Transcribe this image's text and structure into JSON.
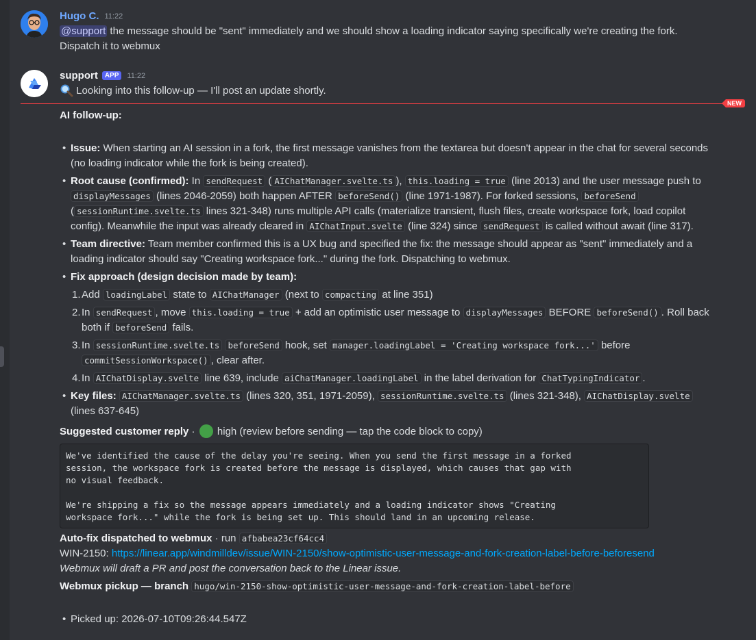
{
  "msg1": {
    "author": "Hugo C.",
    "time": "11:22",
    "mention": "@support",
    "text1": " the message should be \"sent\" immediately and we should show a loading indicator saying specifically we're creating the fork.",
    "text2": "Dispatch it to webmux"
  },
  "msg2": {
    "author": "support",
    "badge": "APP",
    "time": "11:22",
    "text": "Looking into this follow-up — I'll post an update shortly."
  },
  "new_label": "NEW",
  "body": {
    "heading": "AI follow-up:",
    "issue_label": "Issue:",
    "issue_l1": " When starting an AI session in a fork, the first message vanishes from the textarea but doesn't appear in the chat for several seconds",
    "issue_l2": "(no loading indicator while the fork is being created).",
    "rc_label": "Root cause (confirmed):",
    "rc_l1_a": " In ",
    "rc_code1": "sendRequest",
    "rc_l1_b": " (",
    "rc_code2": "AIChatManager.svelte.ts",
    "rc_l1_c": "), ",
    "rc_code3": "this.loading = true",
    "rc_l1_d": " (line 2013) and the user message push to",
    "rc_code4": "displayMessages",
    "rc_l2_a": " (lines 2046-2059) both happen AFTER ",
    "rc_code5": "beforeSend()",
    "rc_l2_b": " (line 1971-1987). For forked sessions, ",
    "rc_code6": "beforeSend",
    "rc_l3_a": "(",
    "rc_code7": "sessionRuntime.svelte.ts",
    "rc_l3_b": " lines 321-348) runs multiple API calls (materialize transient, flush files, create workspace fork, load copilot",
    "rc_l4_a": "config). Meanwhile the input was already cleared in ",
    "rc_code8": "AIChatInput.svelte",
    "rc_l4_b": " (line 324) since ",
    "rc_code9": "sendRequest",
    "rc_l4_c": " is called without await (line 317).",
    "td_label": "Team directive:",
    "td_l1": " Team member confirmed this is a UX bug and specified the fix: the message should appear as \"sent\" immediately and a",
    "td_l2": "loading indicator should say \"Creating workspace fork...\" during the fork. Dispatching to webmux.",
    "fa_label": "Fix approach (design decision made by team):",
    "s1_n": "1.",
    "s1_a": "Add ",
    "s1_c1": "loadingLabel",
    "s1_b": " state to ",
    "s1_c2": "AIChatManager",
    "s1_d": " (next to ",
    "s1_c3": "compacting",
    "s1_e": " at line 351)",
    "s2_n": "2.",
    "s2_a": "In ",
    "s2_c1": "sendRequest",
    "s2_b": ", move ",
    "s2_c2": "this.loading = true",
    "s2_d": " + add an optimistic user message to ",
    "s2_c3": "displayMessages",
    "s2_e": " BEFORE ",
    "s2_c4": "beforeSend()",
    "s2_f": ". Roll back",
    "s2_l2_a": "both if ",
    "s2_c5": "beforeSend",
    "s2_l2_b": " fails.",
    "s3_n": "3.",
    "s3_a": "In ",
    "s3_c1": "sessionRuntime.svelte.ts",
    "s3_b": " ",
    "s3_c2": "beforeSend",
    "s3_d": " hook, set ",
    "s3_c3": "manager.loadingLabel = 'Creating workspace fork...'",
    "s3_e": " before",
    "s3_c4": "commitSessionWorkspace()",
    "s3_f": ", clear after.",
    "s4_n": "4.",
    "s4_a": "In ",
    "s4_c1": "AIChatDisplay.svelte",
    "s4_b": " line 639, include ",
    "s4_c2": "aiChatManager.loadingLabel",
    "s4_d": " in the label derivation for ",
    "s4_c3": "ChatTypingIndicator",
    "s4_e": ".",
    "kf_label": "Key files:",
    "kf_c1": "AIChatManager.svelte.ts",
    "kf_a": " (lines 320, 351, 1971-2059), ",
    "kf_c2": "sessionRuntime.svelte.ts",
    "kf_b": " (lines 321-348), ",
    "kf_c3": "AIChatDisplay.svelte",
    "kf_l2": "(lines 637-645)",
    "sr_label": "Suggested customer reply",
    "sr_sep": " · ",
    "sr_conf": " high (review before sending — tap the code block to copy)",
    "reply_text": "We've identified the cause of the delay you're seeing. When you send the first message in a forked\nsession, the workspace fork is created before the message is displayed, which causes that gap with\nno visual feedback.\n\nWe're shipping a fix so the message appears immediately and a loading indicator shows \"Creating\nworkspace fork...\" while the fork is being set up. This should land in an upcoming release.",
    "ad_label": "Auto-fix dispatched to webmux",
    "ad_run": " · run ",
    "ad_code": "afbabea23cf64cc4",
    "win_label": "WIN-2150: ",
    "win_link": "https://linear.app/windmilldev/issue/WIN-2150/show-optimistic-user-message-and-fork-creation-label-before-beforesend",
    "webmux_note": "Webmux will draft a PR and post the conversation back to the Linear issue.",
    "wp_label": "Webmux pickup — branch",
    "wp_code": "hugo/win-2150-show-optimistic-user-message-and-fork-creation-label-before",
    "picked": "Picked up: 2026-07-10T09:26:44.547Z"
  }
}
